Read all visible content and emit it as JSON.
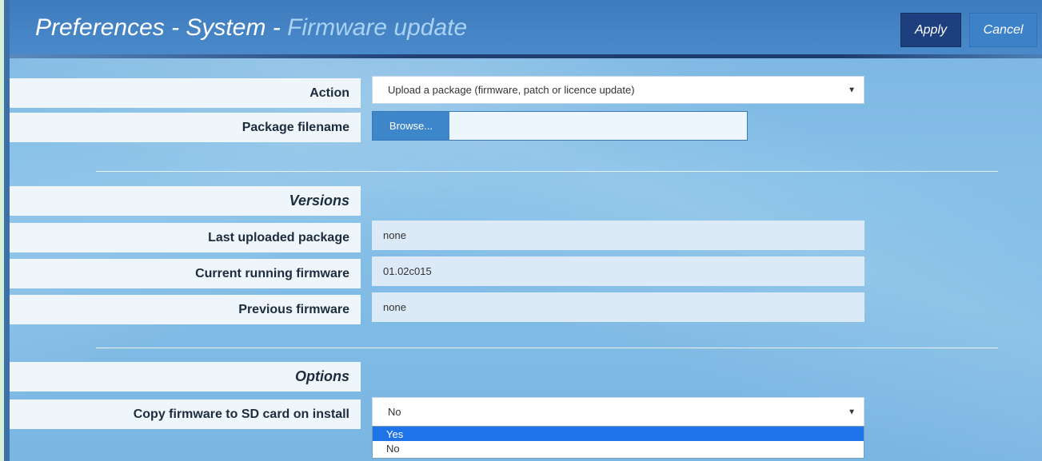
{
  "header": {
    "title_main": "Preferences - System - ",
    "title_sub": "Firmware update",
    "apply_label": "Apply",
    "cancel_label": "Cancel"
  },
  "form": {
    "action": {
      "label": "Action",
      "value": "Upload a package (firmware, patch or licence update)"
    },
    "package": {
      "label": "Package filename",
      "browse_label": "Browse...",
      "value": ""
    }
  },
  "versions": {
    "heading": "Versions",
    "rows": [
      {
        "label": "Last uploaded package",
        "value": "none"
      },
      {
        "label": "Current running firmware",
        "value": "01.02c015"
      },
      {
        "label": "Previous firmware",
        "value": "none"
      }
    ]
  },
  "options": {
    "heading": "Options",
    "copy_firmware": {
      "label": "Copy firmware to SD card on install",
      "value": "No",
      "dropdown_options": [
        "Yes",
        "No"
      ],
      "highlighted_option": "Yes"
    }
  },
  "icons": {
    "select_arrow": "chevron-down-icon"
  },
  "colors": {
    "apply_bg": "#1e3f7e",
    "cancel_bg": "#3b82c8",
    "highlight": "#1e73e8"
  }
}
